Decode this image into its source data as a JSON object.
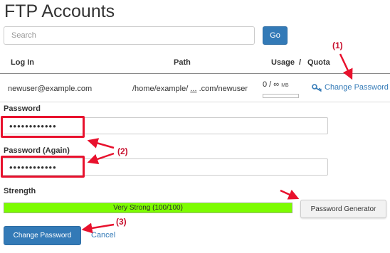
{
  "page": {
    "title": "FTP Accounts"
  },
  "search": {
    "placeholder": "Search",
    "go_label": "Go"
  },
  "table": {
    "headers": {
      "login": "Log In",
      "path": "Path",
      "usage": "Usage",
      "separator": "/",
      "quota": "Quota"
    },
    "row": {
      "login": "newuser@example.com",
      "path_start": "/home/example/",
      "path_ellipsis": "...",
      "path_end": ".com/newuser",
      "usage": "0 / ∞",
      "usage_unit": "MB",
      "action": "Change Password"
    }
  },
  "form": {
    "password_label": "Password",
    "password_value": "••••••••••••",
    "password_again_label": "Password (Again)",
    "password_again_value": "••••••••••••",
    "strength_label": "Strength",
    "strength_text": "Very Strong (100/100)",
    "strength_fraction": 1.0,
    "generator_label": "Password Generator",
    "submit_label": "Change Password",
    "cancel_label": "Cancel"
  },
  "annotations": {
    "step1": "(1)",
    "step2": "(2)",
    "step3": "(3)"
  },
  "icons": {
    "change_password": "key-icon"
  },
  "colors": {
    "primary": "#337ab7",
    "annotation": "#e8112d",
    "strength": "#7cfc00"
  }
}
